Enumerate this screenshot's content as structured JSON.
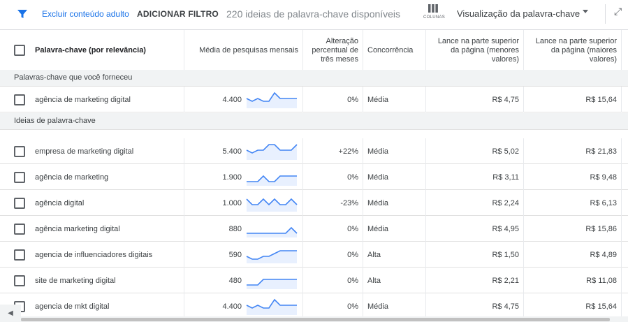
{
  "toolbar": {
    "filter_icon": "filter-icon",
    "exclude_adult": "Excluir conteúdo adulto",
    "add_filter": "ADICIONAR FILTRO",
    "count_text": "220 ideias de palavra-chave disponíveis",
    "columns_label": "COLUNAS",
    "view_label": "Visualização da palavra-chave",
    "accent": "#1a73e8"
  },
  "headers": {
    "keyword": "Palavra-chave (por relevância)",
    "avg_searches": "Média de pesquisas mensais",
    "change": "Alteração percentual de três meses",
    "competition": "Concorrência",
    "bid_low": "Lance na parte superior da página (menores valores)",
    "bid_high": "Lance na parte superior da página (maiores valores)"
  },
  "groups": {
    "provided": "Palavras-chave que você forneceu",
    "ideas": "Ideias de palavra-chave"
  },
  "rows": [
    {
      "keyword": "agência de marketing digital",
      "searches": "4.400",
      "trend": [
        3,
        2,
        3,
        2,
        2,
        5,
        3,
        3,
        3,
        3
      ],
      "change": "0%",
      "competition": "Média",
      "bid_low": "R$ 4,75",
      "bid_high": "R$ 15,64"
    },
    {
      "keyword": "empresa de marketing digital",
      "searches": "5.400",
      "trend": [
        3,
        2,
        3,
        3,
        5,
        5,
        3,
        3,
        3,
        5
      ],
      "change": "+22%",
      "competition": "Média",
      "bid_low": "R$ 5,02",
      "bid_high": "R$ 21,83"
    },
    {
      "keyword": "agência de marketing",
      "searches": "1.900",
      "trend": [
        1,
        1,
        1,
        3,
        1,
        1,
        3,
        3,
        3,
        3
      ],
      "change": "0%",
      "competition": "Média",
      "bid_low": "R$ 3,11",
      "bid_high": "R$ 9,48"
    },
    {
      "keyword": "agência digital",
      "searches": "1.000",
      "trend": [
        4,
        2,
        2,
        4,
        2,
        4,
        2,
        2,
        4,
        2
      ],
      "change": "-23%",
      "competition": "Média",
      "bid_low": "R$ 2,24",
      "bid_high": "R$ 6,13"
    },
    {
      "keyword": "agência marketing digital",
      "searches": "880",
      "trend": [
        1,
        1,
        1,
        1,
        1,
        1,
        1,
        1,
        3,
        1
      ],
      "change": "0%",
      "competition": "Média",
      "bid_low": "R$ 4,95",
      "bid_high": "R$ 15,86"
    },
    {
      "keyword": "agencia de influenciadores digitais",
      "searches": "590",
      "trend": [
        2,
        1,
        1,
        2,
        2,
        3,
        4,
        4,
        4,
        4
      ],
      "change": "0%",
      "competition": "Alta",
      "bid_low": "R$ 1,50",
      "bid_high": "R$ 4,89"
    },
    {
      "keyword": "site de marketing digital",
      "searches": "480",
      "trend": [
        1,
        1,
        1,
        3,
        3,
        3,
        3,
        3,
        3,
        3
      ],
      "change": "0%",
      "competition": "Alta",
      "bid_low": "R$ 2,21",
      "bid_high": "R$ 11,08"
    },
    {
      "keyword": "agencia de mkt digital",
      "searches": "4.400",
      "trend": [
        3,
        2,
        3,
        2,
        2,
        5,
        3,
        3,
        3,
        3
      ],
      "change": "0%",
      "competition": "Média",
      "bid_low": "R$ 4,75",
      "bid_high": "R$ 15,64"
    }
  ]
}
